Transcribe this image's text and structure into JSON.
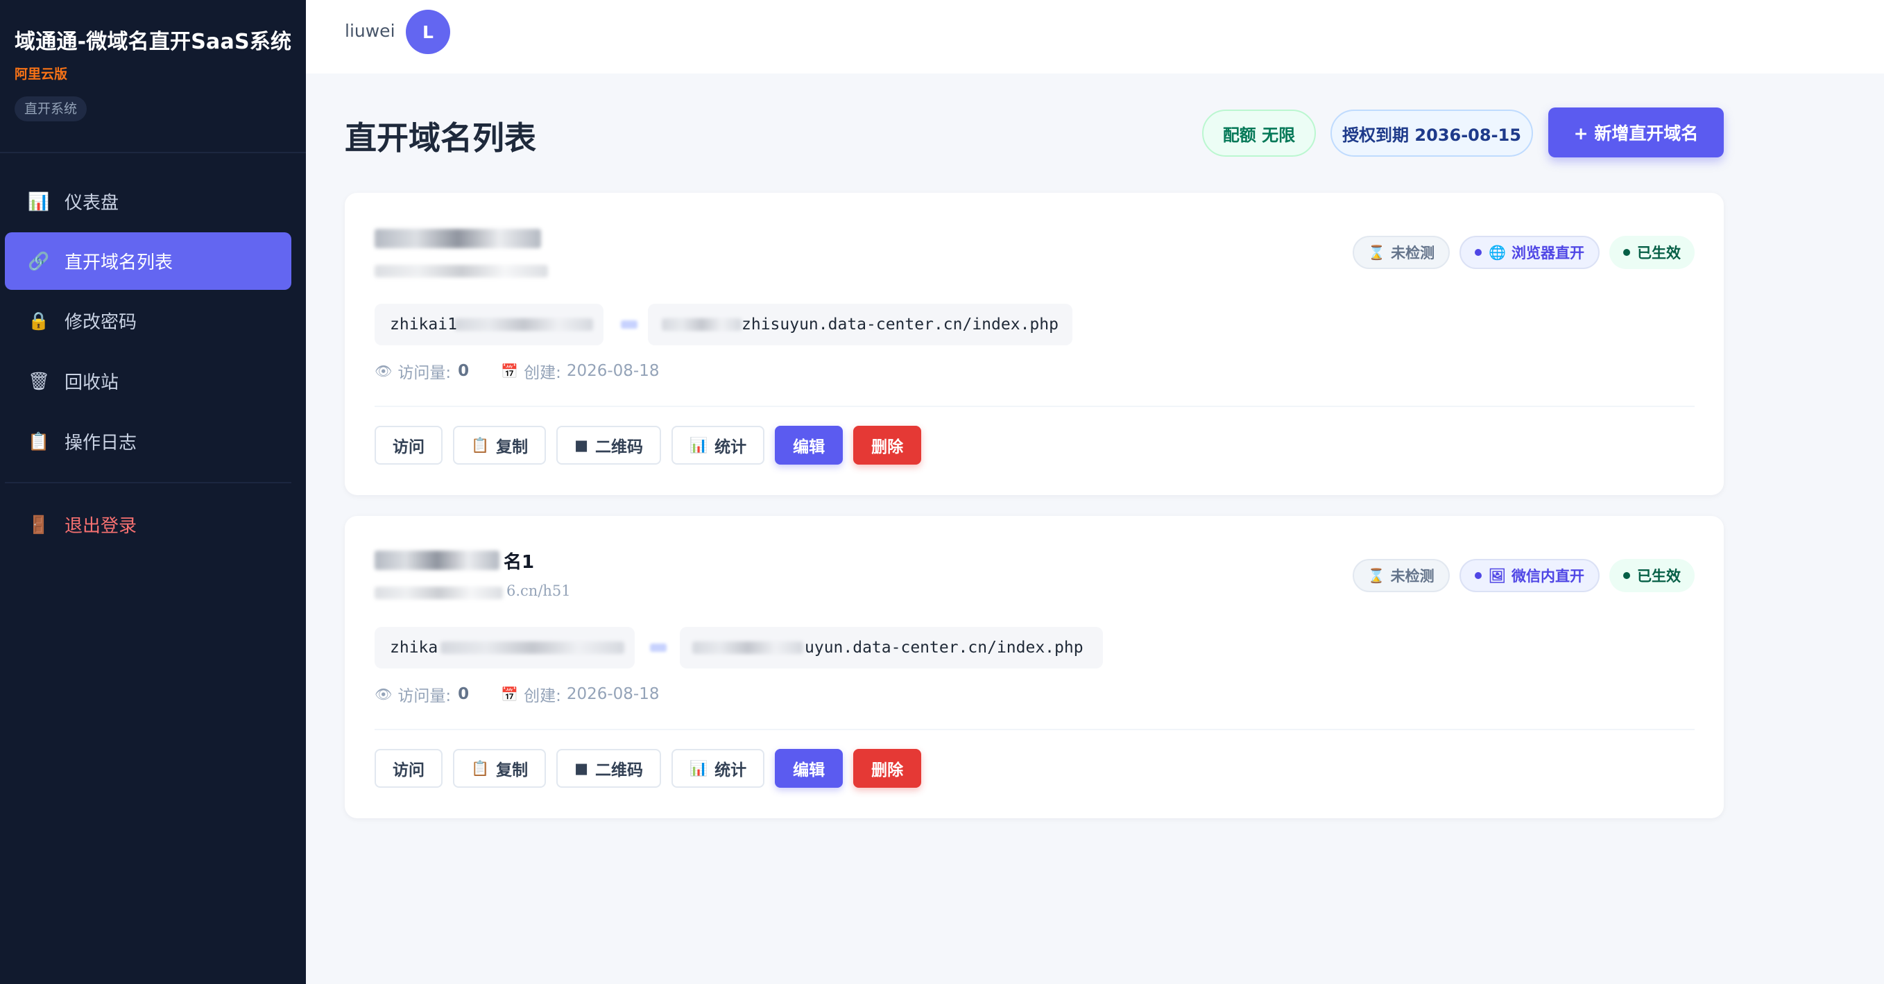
{
  "sidebar": {
    "brand_title": "域通通-微域名直开SaaS系统",
    "edition": "阿里云版",
    "tag": "直开系统",
    "items": [
      {
        "label": "仪表盘",
        "icon": "📊"
      },
      {
        "label": "直开域名列表",
        "icon": "🔗"
      },
      {
        "label": "修改密码",
        "icon": "🔒"
      },
      {
        "label": "回收站",
        "icon": "🗑"
      },
      {
        "label": "操作日志",
        "icon": "📋"
      }
    ],
    "logout": {
      "label": "退出登录",
      "icon": "🚪"
    }
  },
  "topbar": {
    "username": "liuwei",
    "avatar_letter": "L"
  },
  "page": {
    "title": "直开域名列表",
    "quota": "配额 无限",
    "expire": "授权到期 2036-08-15",
    "add_button": "+ 新增直开域名"
  },
  "cards": [
    {
      "name_visible": "",
      "sub_visible": "",
      "check_badge": "未检测",
      "mode_badge": "浏览器直开",
      "mode_icon": "🌐",
      "status_badge": "已生效",
      "source_prefix": "zhikai1",
      "target_suffix": "zhisuyun.data-center.cn/index.php",
      "visits_label": "访问量:",
      "visits": "0",
      "created_label": "创建:",
      "created": "2026-08-18"
    },
    {
      "name_visible": "名1",
      "sub_visible": "6.cn/h51",
      "check_badge": "未检测",
      "mode_badge": "微信内直开",
      "mode_icon": "🖼",
      "status_badge": "已生效",
      "source_prefix": "zhika",
      "target_suffix": "uyun.data-center.cn/index.php",
      "visits_label": "访问量:",
      "visits": "0",
      "created_label": "创建:",
      "created": "2026-08-18"
    }
  ],
  "actions": {
    "visit": "访问",
    "copy": "复制",
    "qrcode": "二维码",
    "stats": "统计",
    "edit": "编辑",
    "delete": "删除"
  },
  "colors": {
    "sidebar_bg": "#111a2e",
    "accent": "#6366f1",
    "danger": "#e53935",
    "success": "#065f46"
  }
}
